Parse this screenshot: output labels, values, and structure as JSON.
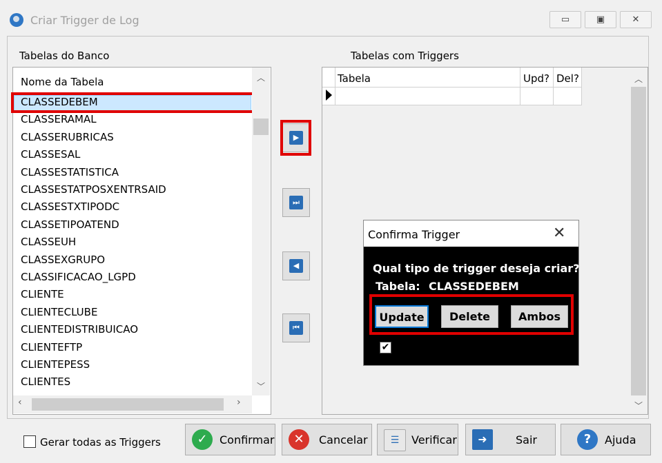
{
  "window": {
    "title": "Criar Trigger de Log",
    "controls": {
      "minimize": "▭",
      "maximize": "▣",
      "close": "✕"
    }
  },
  "left_panel": {
    "label": "Tabelas do Banco",
    "column_header": "Nome da Tabela",
    "rows": [
      "CLASSEDEBEM",
      "CLASSERAMAL",
      "CLASSERUBRICAS",
      "CLASSESAL",
      "CLASSESTATISTICA",
      "CLASSESTATPOSXENTRSAID",
      "CLASSESTXTIPODC",
      "CLASSETIPOATEND",
      "CLASSEUH",
      "CLASSEXGRUPO",
      "CLASSIFICACAO_LGPD",
      "CLIENTE",
      "CLIENTECLUBE",
      "CLIENTEDISTRIBUICAO",
      "CLIENTEFTP",
      "CLIENTEPESS",
      "CLIENTES"
    ],
    "selected_row": "CLASSEDEBEM"
  },
  "right_panel": {
    "label": "Tabelas com Triggers",
    "columns": [
      "Tabela",
      "Upd?",
      "Del?"
    ]
  },
  "move_buttons": {
    "add_one": "▶",
    "add_all": "⏭",
    "remove_one": "◀",
    "remove_all": "⏮"
  },
  "dialog": {
    "title": "Confirma Trigger",
    "question": "Qual tipo de trigger deseja criar?",
    "table_label": "Tabela:",
    "table_value": "CLASSEDEBEM",
    "buttons": {
      "update": "Update",
      "delete": "Delete",
      "ambos": "Ambos"
    },
    "checkbox_checked": true,
    "check_mark": "✔"
  },
  "footer": {
    "gerar_todas_label": "Gerar todas as Triggers",
    "buttons": {
      "confirmar": "Confirmar",
      "cancelar": "Cancelar",
      "verificar": "Verificar",
      "sair": "Sair",
      "ajuda": "Ajuda"
    }
  },
  "colors": {
    "highlight_red": "#e00000",
    "selection": "#cce8ff",
    "icon_blue": "#2a6db5",
    "confirm_green": "#2eab4e",
    "cancel_red": "#d9342b",
    "help_blue": "#2f77c5"
  }
}
